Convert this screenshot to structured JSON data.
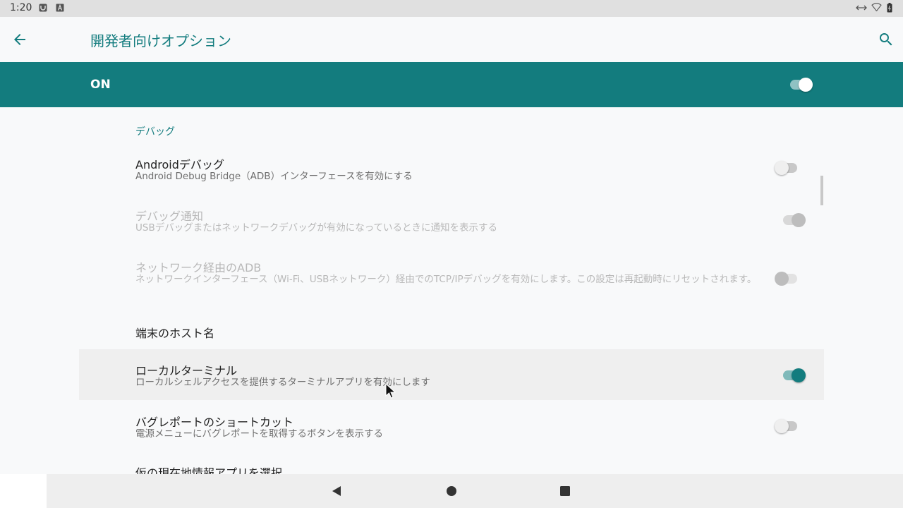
{
  "status_bar": {
    "time": "1:20",
    "icons": [
      "image-notification-icon",
      "keyboard-a-icon",
      "data-arrows-icon",
      "wifi-icon",
      "battery-icon"
    ]
  },
  "app_bar": {
    "title": "開発者向けオプション",
    "back_icon": "arrow-back-icon",
    "search_icon": "search-icon"
  },
  "master_switch": {
    "label": "ON",
    "checked": true
  },
  "section": {
    "header": "デバッグ"
  },
  "settings": [
    {
      "title": "Androidデバッグ",
      "summary": "Android Debug Bridge（ADB）インターフェースを有効にする",
      "checked": false,
      "enabled": true
    },
    {
      "title": "デバッグ通知",
      "summary": "USBデバッグまたはネットワークデバッグが有効になっているときに通知を表示する",
      "checked": true,
      "enabled": false
    },
    {
      "title": "ネットワーク経由のADB",
      "summary": "ネットワークインターフェース（Wi-Fi、USBネットワーク）経由でのTCP/IPデバッグを有効にします。この設定は再起動時にリセットされます。",
      "checked": false,
      "enabled": false
    },
    {
      "title": "端末のホスト名"
    },
    {
      "title": "ローカルターミナル",
      "summary": "ローカルシェルアクセスを提供するターミナルアプリを有効にします",
      "checked": true,
      "enabled": true
    },
    {
      "title": "バグレポートのショートカット",
      "summary": "電源メニューにバグレポートを取得するボタンを表示する",
      "checked": false,
      "enabled": true
    },
    {
      "title": "仮の現在地情報アプリを選択"
    }
  ],
  "nav_bar": {
    "buttons": [
      "back-triangle-icon",
      "home-circle-icon",
      "recents-square-icon"
    ]
  },
  "colors": {
    "accent": "#137c7e",
    "background": "#f8f9fa",
    "status_bar": "#e0e0e0"
  }
}
